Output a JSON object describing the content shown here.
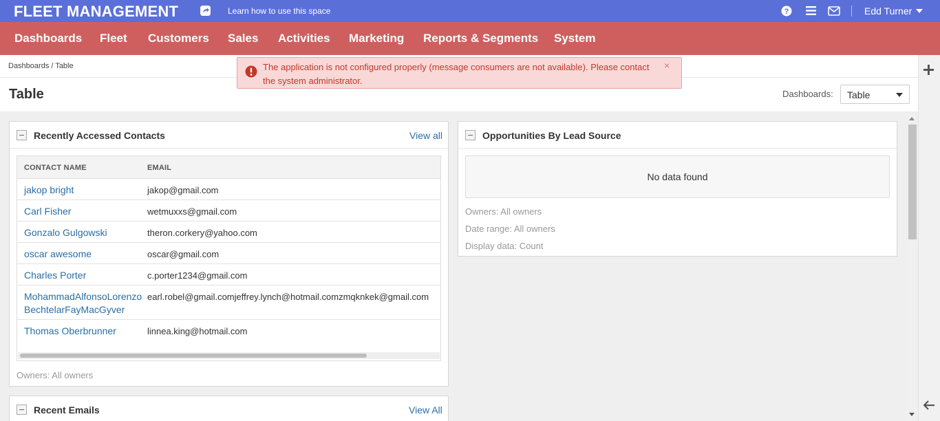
{
  "topbar": {
    "brand": "FLEET MANAGEMENT",
    "learn_link": "Learn how to use this space",
    "user_name": "Edd Turner"
  },
  "nav": {
    "items": [
      "Dashboards",
      "Fleet",
      "Customers",
      "Sales",
      "Activities",
      "Marketing",
      "Reports & Segments",
      "System"
    ]
  },
  "breadcrumb": {
    "root": "Dashboards",
    "separator": "/",
    "current": "Table"
  },
  "page": {
    "title": "Table",
    "dashboards_label": "Dashboards:",
    "dashboards_selected": "Table"
  },
  "alert": {
    "message": "The application is not configured properly (message consumers are not available). Please contact the system administrator.",
    "close": "×"
  },
  "contacts_widget": {
    "title": "Recently Accessed Contacts",
    "view_all": "View all",
    "columns": [
      "CONTACT NAME",
      "EMAIL"
    ],
    "rows": [
      {
        "name": "jakop bright",
        "email": "jakop@gmail.com"
      },
      {
        "name": "Carl Fisher",
        "email": "wetmuxxs@gmail.com"
      },
      {
        "name": "Gonzalo Gulgowski",
        "email": "theron.corkery@yahoo.com"
      },
      {
        "name": "oscar awesome",
        "email": "oscar@gmail.com"
      },
      {
        "name": "Charles Porter",
        "email": "c.porter1234@gmail.com"
      },
      {
        "name": "MohammadAlfonsoLorenzo BechtelarFayMacGyver",
        "email": "earl.robel@gmail.comjeffrey.lynch@hotmail.comzmqknkek@gmail.com"
      },
      {
        "name": "Thomas Oberbrunner",
        "email": "linnea.king@hotmail.com"
      }
    ],
    "owners_note": "Owners: All owners"
  },
  "opportunities_widget": {
    "title": "Opportunities By Lead Source",
    "no_data": "No data found",
    "owners": "Owners: All owners",
    "date_range": "Date range: All owners",
    "display_data": "Display data: Count"
  },
  "emails_widget": {
    "title": "Recent Emails",
    "view_all": "View All"
  },
  "colors": {
    "topbar": "#5b6fd9",
    "navbar": "#cf5f5f",
    "link": "#2a6ea6",
    "alert_bg": "#f9d8d8",
    "alert_text": "#c0392b"
  },
  "icons": [
    "share-icon",
    "help-icon",
    "menu-icon",
    "mail-icon",
    "chevron-down-icon",
    "plus-icon",
    "back-arrow-icon",
    "alert-icon",
    "close-icon"
  ]
}
